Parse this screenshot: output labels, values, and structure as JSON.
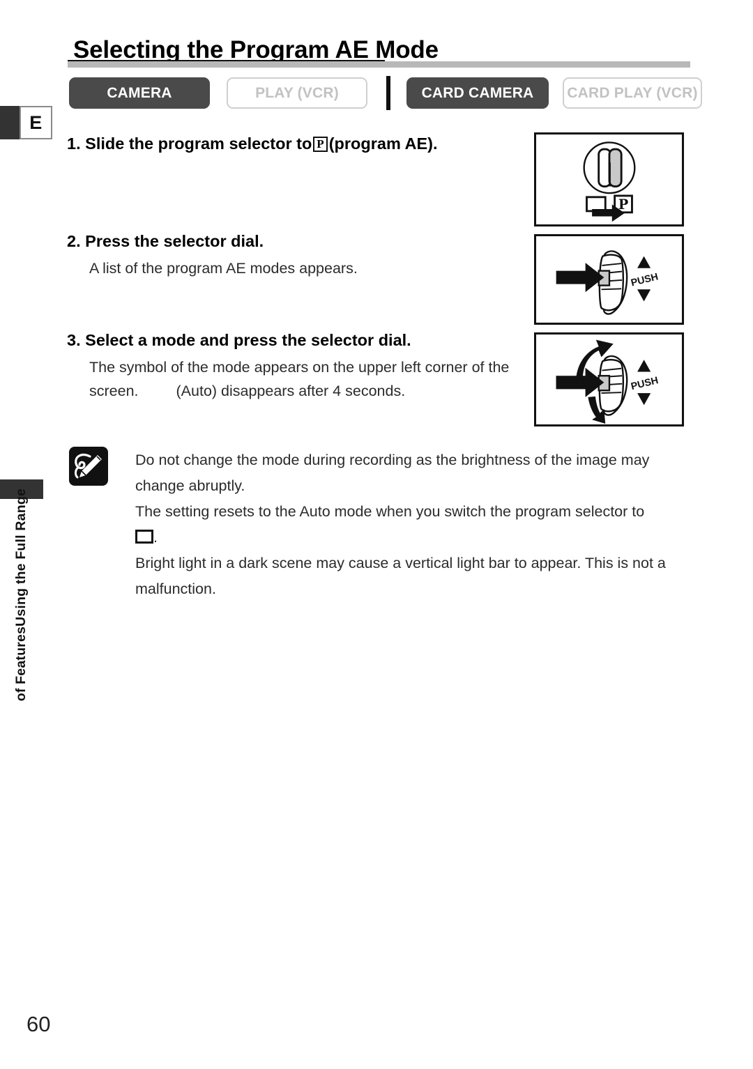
{
  "page": {
    "number": "60",
    "language_tab": "E",
    "section_label_lines": [
      "Using the Full Range",
      "of Features"
    ]
  },
  "header": {
    "title": "Selecting the Program AE Mode"
  },
  "modes": [
    {
      "label": "CAMERA",
      "state": "active"
    },
    {
      "label": "PLAY (VCR)",
      "state": "inactive"
    },
    {
      "label": "CARD CAMERA",
      "state": "active"
    },
    {
      "label": "CARD PLAY (VCR)",
      "state": "inactive"
    }
  ],
  "steps": [
    {
      "number": "1.",
      "heading_before": "Slide the program selector to",
      "symbol": "P",
      "heading_after": "(program AE).",
      "body": ""
    },
    {
      "number": "2.",
      "heading": "Press the selector dial.",
      "body": "A list of the program AE modes appears."
    },
    {
      "number": "3.",
      "heading": "Select a mode and press the selector dial.",
      "body_line1": "The symbol of the mode appears on the upper left corner of the",
      "body_line2a": "screen.",
      "body_line2b": "(Auto) disappears after 4 seconds."
    }
  ],
  "figures": [
    {
      "name": "program-selector-switch",
      "labels": [
        "P"
      ]
    },
    {
      "name": "selector-dial-press",
      "labels": [
        "PUSH"
      ]
    },
    {
      "name": "selector-dial-rotate-press",
      "labels": [
        "PUSH"
      ]
    }
  ],
  "notes": {
    "icon": "memo-pencil-icon",
    "items": [
      "Do not change the mode during recording as the brightness of the image may change abruptly.",
      "The setting resets to the Auto mode when you switch the program selector to",
      "Bright light in a dark scene may cause a vertical light bar to appear. This is not a malfunction."
    ]
  },
  "colors": {
    "active_button": "#4a4a4a",
    "inactive_button_border": "#cfcfcf",
    "inactive_button_text": "#c2c2c2",
    "rule": "#b8b8b8",
    "tab_block": "#333333"
  }
}
